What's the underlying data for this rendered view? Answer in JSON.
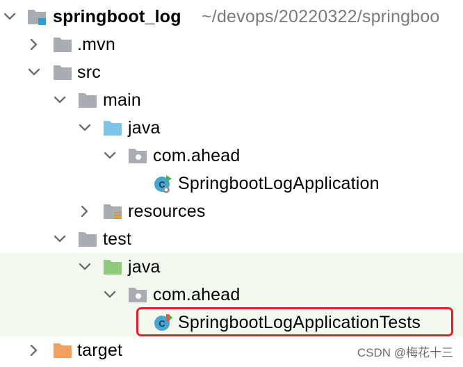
{
  "project": {
    "name": "springboot_log",
    "path": "~/devops/20220322/springboo"
  },
  "tree": {
    "mvn": ".mvn",
    "src": "src",
    "main": "main",
    "main_java": "java",
    "main_pkg": "com.ahead",
    "main_class": "SpringbootLogApplication",
    "resources": "resources",
    "test": "test",
    "test_java": "java",
    "test_pkg": "com.ahead",
    "test_class": "SpringbootLogApplicationTests",
    "target": "target"
  },
  "watermark": "CSDN @梅花十三",
  "colors": {
    "folder_gray": "#a9adb3",
    "source_blue": "#7ec4e6",
    "test_green": "#8fc97a",
    "target_orange": "#f0a060",
    "highlight_red": "#e0212b",
    "class_cyan": "#48a6cf",
    "run_green": "#4caf50"
  },
  "icons": {
    "expanded": "chevron-down-icon",
    "collapsed": "chevron-right-icon",
    "module": "module-folder-icon",
    "folder": "folder-icon",
    "package": "package-icon",
    "class": "java-class-icon",
    "test_class": "java-test-class-icon"
  }
}
